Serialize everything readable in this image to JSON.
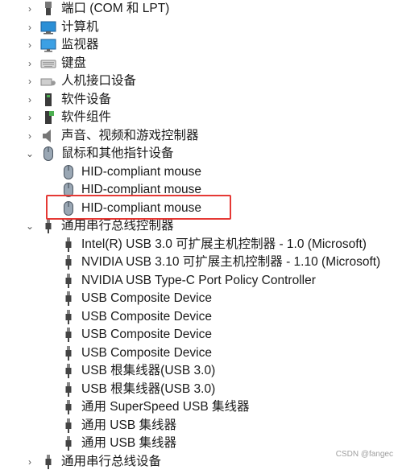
{
  "tree": {
    "items": [
      {
        "label": "端口 (COM 和 LPT)",
        "icon": "port-icon",
        "level": 0,
        "expanded": false
      },
      {
        "label": "计算机",
        "icon": "computer-icon",
        "level": 0,
        "expanded": false
      },
      {
        "label": "监视器",
        "icon": "monitor-icon",
        "level": 0,
        "expanded": false
      },
      {
        "label": "键盘",
        "icon": "keyboard-icon",
        "level": 0,
        "expanded": false
      },
      {
        "label": "人机接口设备",
        "icon": "hid-icon",
        "level": 0,
        "expanded": false
      },
      {
        "label": "软件设备",
        "icon": "software-device-icon",
        "level": 0,
        "expanded": false
      },
      {
        "label": "软件组件",
        "icon": "software-component-icon",
        "level": 0,
        "expanded": false
      },
      {
        "label": "声音、视频和游戏控制器",
        "icon": "speaker-icon",
        "level": 0,
        "expanded": false
      },
      {
        "label": "鼠标和其他指针设备",
        "icon": "mouse-icon",
        "level": 0,
        "expanded": true
      },
      {
        "label": "HID-compliant mouse",
        "icon": "mouse-icon",
        "level": 1
      },
      {
        "label": "HID-compliant mouse",
        "icon": "mouse-icon",
        "level": 1
      },
      {
        "label": "HID-compliant mouse",
        "icon": "mouse-icon",
        "level": 1,
        "highlighted": true
      },
      {
        "label": "通用串行总线控制器",
        "icon": "usb-icon",
        "level": 0,
        "expanded": true
      },
      {
        "label": "Intel(R) USB 3.0 可扩展主机控制器 - 1.0 (Microsoft)",
        "icon": "usb-icon",
        "level": 1
      },
      {
        "label": "NVIDIA USB 3.10 可扩展主机控制器 - 1.10 (Microsoft)",
        "icon": "usb-icon",
        "level": 1
      },
      {
        "label": "NVIDIA USB Type-C Port Policy Controller",
        "icon": "usb-icon",
        "level": 1
      },
      {
        "label": "USB Composite Device",
        "icon": "usb-icon",
        "level": 1
      },
      {
        "label": "USB Composite Device",
        "icon": "usb-icon",
        "level": 1
      },
      {
        "label": "USB Composite Device",
        "icon": "usb-icon",
        "level": 1
      },
      {
        "label": "USB Composite Device",
        "icon": "usb-icon",
        "level": 1
      },
      {
        "label": "USB 根集线器(USB 3.0)",
        "icon": "usb-icon",
        "level": 1
      },
      {
        "label": "USB 根集线器(USB 3.0)",
        "icon": "usb-icon",
        "level": 1
      },
      {
        "label": "通用 SuperSpeed USB 集线器",
        "icon": "usb-icon",
        "level": 1
      },
      {
        "label": "通用 USB 集线器",
        "icon": "usb-icon",
        "level": 1
      },
      {
        "label": "通用 USB 集线器",
        "icon": "usb-icon",
        "level": 1
      },
      {
        "label": "通用串行总线设备",
        "icon": "usb-icon",
        "level": 0,
        "expanded": false
      }
    ]
  },
  "watermark": "CSDN @fangec",
  "colors": {
    "highlight": "#e53935",
    "text": "#1a1a1a",
    "background": "#ffffff"
  }
}
